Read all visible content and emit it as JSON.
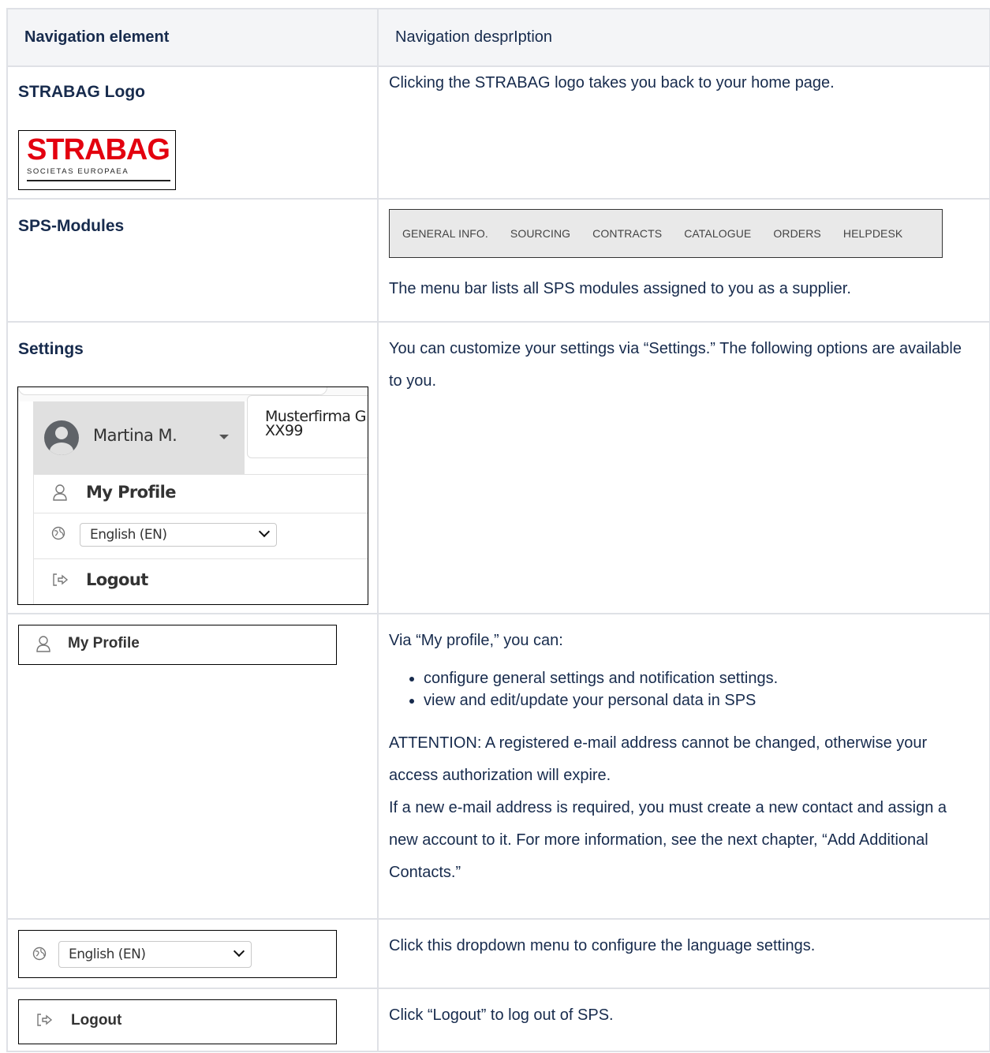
{
  "table": {
    "col1_header": "Navigation element",
    "col2_header": "Navigation desprIption"
  },
  "logo_row": {
    "label": "STRABAG Logo",
    "logo_text": "STRABAG",
    "logo_sub": "SOCIETAS EUROPAEA",
    "description": "Clicking the STRABAG logo takes you back to your home page."
  },
  "modules_row": {
    "label": "SPS-Modules",
    "menu_items": [
      "GENERAL INFO.",
      "SOURCING",
      "CONTRACTS",
      "CATALOGUE",
      "ORDERS",
      "HELPDESK"
    ],
    "description": "The menu bar lists all SPS modules assigned to you as a supplier."
  },
  "settings_row": {
    "label": "Settings",
    "user_name": "Martina M.",
    "company": "Musterfirma G\nXX99",
    "menu": {
      "profile": "My Profile",
      "language": "English (EN)",
      "logout": "Logout"
    },
    "description": "You can customize your settings via “Settings.” The following options are available to you."
  },
  "profile_row": {
    "widget_label": "My Profile",
    "intro": "Via “My profile,” you can:",
    "bullets": [
      "configure general settings and notification settings.",
      "view and edit/update your personal data in SPS"
    ],
    "attention": "ATTENTION: A registered e-mail address cannot be changed, otherwise your access authorization will expire.",
    "more": "If a new e-mail address is required, you must create a new contact and assign a new account to it. For more information, see the next chapter, “Add Additional Contacts.”"
  },
  "language_row": {
    "widget_value": "English (EN)",
    "description": "Click this dropdown menu to configure the language settings."
  },
  "logout_row": {
    "widget_label": "Logout",
    "description": "Click “Logout” to log out of SPS."
  }
}
